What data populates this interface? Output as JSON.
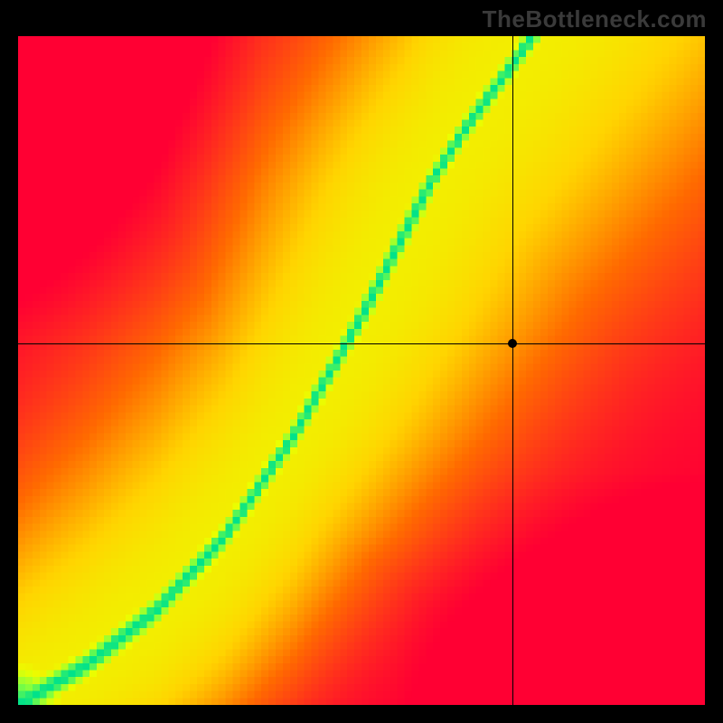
{
  "watermark": "TheBottleneck.com",
  "chart_data": {
    "type": "heatmap",
    "title": "",
    "xlabel": "",
    "ylabel": "",
    "xlim": [
      0,
      100
    ],
    "ylim": [
      0,
      100
    ],
    "crosshair": {
      "x": 72,
      "y": 54
    },
    "marker": {
      "x": 72,
      "y": 54
    },
    "ridge": [
      {
        "x": 0,
        "y": 0
      },
      {
        "x": 10,
        "y": 6
      },
      {
        "x": 20,
        "y": 14
      },
      {
        "x": 30,
        "y": 25
      },
      {
        "x": 40,
        "y": 40
      },
      {
        "x": 50,
        "y": 58
      },
      {
        "x": 55,
        "y": 68
      },
      {
        "x": 60,
        "y": 78
      },
      {
        "x": 65,
        "y": 86
      },
      {
        "x": 70,
        "y": 93
      },
      {
        "x": 75,
        "y": 100
      }
    ],
    "colorscale": [
      {
        "stop": 0.0,
        "color": "#ff0033"
      },
      {
        "stop": 0.35,
        "color": "#ff6a00"
      },
      {
        "stop": 0.6,
        "color": "#ffd400"
      },
      {
        "stop": 0.8,
        "color": "#eaff00"
      },
      {
        "stop": 0.92,
        "color": "#80ff40"
      },
      {
        "stop": 1.0,
        "color": "#00e28a"
      }
    ],
    "grid": false,
    "legend_position": "none",
    "description": "Pixelated heatmap with a narrow green ridge curving from lower-left to upper-right; background fades from red через orange/yellow toward the ridge. A black crosshair and dot mark a point at roughly (72, 54) in chart coordinates."
  },
  "canvas": {
    "rows": 96,
    "cols": 96,
    "ridge_sigma": 3.0,
    "bg_sigma_base": 50,
    "bg_gain": 0.72
  }
}
